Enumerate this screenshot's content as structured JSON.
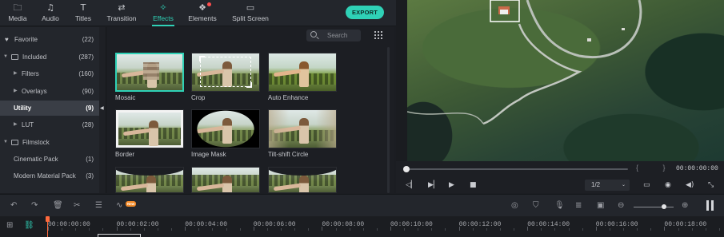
{
  "nav": {
    "items": [
      {
        "label": "Media",
        "icon": "folder-icon",
        "glyph": "🗀"
      },
      {
        "label": "Audio",
        "icon": "music-note-icon",
        "glyph": "♫"
      },
      {
        "label": "Titles",
        "icon": "text-icon",
        "glyph": "T"
      },
      {
        "label": "Transition",
        "icon": "transition-icon",
        "glyph": "⇄"
      },
      {
        "label": "Effects",
        "icon": "effects-icon",
        "glyph": "✧",
        "active": true
      },
      {
        "label": "Elements",
        "icon": "elements-icon",
        "glyph": "❖"
      },
      {
        "label": "Split Screen",
        "icon": "split-screen-icon",
        "glyph": "▭"
      }
    ],
    "export_label": "EXPORT",
    "accent": "#2fd1b6"
  },
  "categories": [
    {
      "label": "Favorite",
      "count": "(22)",
      "icon": "heart-icon"
    },
    {
      "label": "Included",
      "count": "(287)",
      "icon": "folder-icon",
      "expanded": true
    },
    {
      "label": "Filters",
      "count": "(160)"
    },
    {
      "label": "Overlays",
      "count": "(90)"
    },
    {
      "label": "Utility",
      "count": "(9)",
      "selected": true
    },
    {
      "label": "LUT",
      "count": "(28)"
    },
    {
      "label": "Filmstock",
      "count": "",
      "icon": "folder-icon",
      "expanded": true
    },
    {
      "label": "Cinematic Pack",
      "count": "(1)"
    },
    {
      "label": "Modern Material Pack",
      "count": "(3)"
    }
  ],
  "search": {
    "placeholder": "Search"
  },
  "effects": [
    {
      "label": "Mosaic",
      "selected": true
    },
    {
      "label": "Crop"
    },
    {
      "label": "Auto Enhance"
    },
    {
      "label": "Border"
    },
    {
      "label": "Image Mask"
    },
    {
      "label": "Tilt-shift Circle"
    },
    {
      "label": ""
    },
    {
      "label": ""
    },
    {
      "label": ""
    }
  ],
  "player": {
    "time": "00:00:00:00",
    "brackets": "{ }",
    "ratio": "1/2",
    "progress": 0
  },
  "timeline": {
    "tools": [
      "undo-icon",
      "redo-icon",
      "delete-icon",
      "cut-icon",
      "adjust-icon",
      "audio-wave-icon"
    ],
    "new_badge": "New",
    "right_tools": [
      "render-icon",
      "marker-icon",
      "mic-icon",
      "voiceover-icon",
      "subtitle-icon",
      "zoom-out-icon",
      "zoom-in-icon"
    ],
    "zoom_level": 0.75,
    "timestamps": [
      "00:00:00:00",
      "00:00:02:00",
      "00:00:04:00",
      "00:00:06:00",
      "00:00:08:00",
      "00:00:10:00",
      "00:00:12:00",
      "00:00:14:00",
      "00:00:16:00",
      "00:00:18:00"
    ]
  }
}
